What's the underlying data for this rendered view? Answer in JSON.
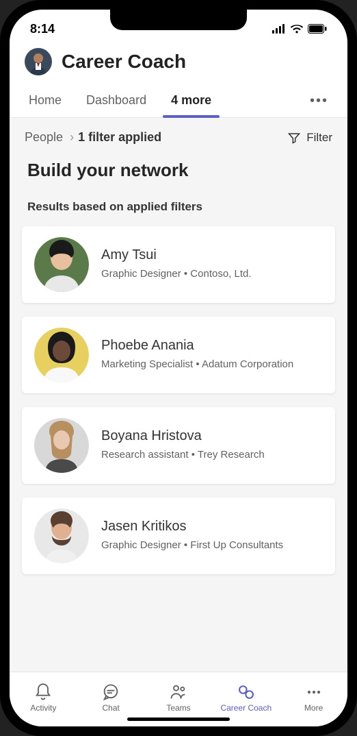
{
  "status": {
    "time": "8:14"
  },
  "header": {
    "title": "Career Coach"
  },
  "tabs": {
    "items": [
      {
        "label": "Home"
      },
      {
        "label": "Dashboard"
      },
      {
        "label": "4 more"
      }
    ]
  },
  "breadcrumb": {
    "root": "People",
    "active": "1 filter applied"
  },
  "filter_label": "Filter",
  "page": {
    "title": "Build your network",
    "results_heading": "Results based on applied filters"
  },
  "people": [
    {
      "name": "Amy Tsui",
      "role": "Graphic Designer • Contoso, Ltd."
    },
    {
      "name": "Phoebe Anania",
      "role": "Marketing Specialist • Adatum Corporation"
    },
    {
      "name": "Boyana Hristova",
      "role": "Research assistant • Trey Research"
    },
    {
      "name": "Jasen Kritikos",
      "role": "Graphic Designer • First Up Consultants"
    }
  ],
  "nav": {
    "items": [
      {
        "label": "Activity"
      },
      {
        "label": "Chat"
      },
      {
        "label": "Teams"
      },
      {
        "label": "Career Coach"
      },
      {
        "label": "More"
      }
    ]
  },
  "colors": {
    "accent": "#5b5fc7"
  }
}
